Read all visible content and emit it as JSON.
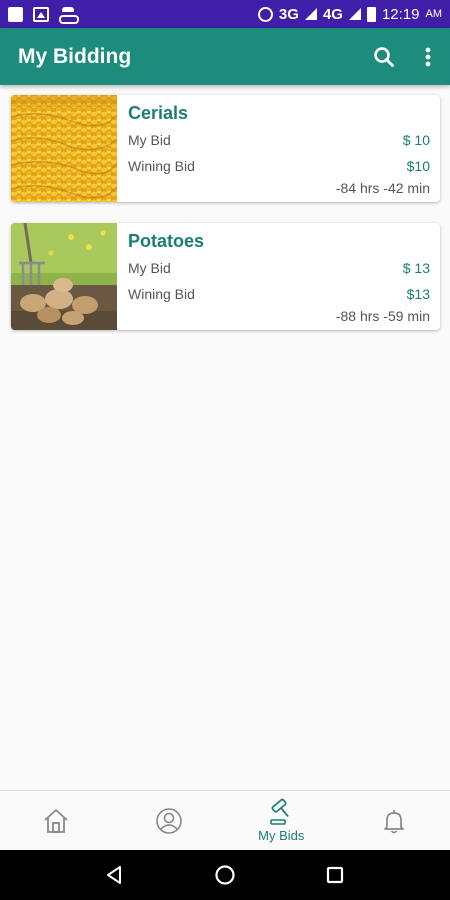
{
  "status_bar": {
    "network_3g": "3G",
    "network_4g": "4G",
    "time": "12:19",
    "ampm": "AM"
  },
  "app_bar": {
    "title": "My Bidding",
    "color": "#1e8c7d"
  },
  "items": [
    {
      "title": "Cerials",
      "my_bid_label": "My Bid",
      "my_bid_value": "$ 10",
      "winning_bid_label": "Wining Bid",
      "winning_bid_value": "$10",
      "time_left": "-84 hrs -42 min",
      "image": "corn-photo"
    },
    {
      "title": "Potatoes",
      "my_bid_label": "My Bid",
      "my_bid_value": "$ 13",
      "winning_bid_label": "Wining Bid",
      "winning_bid_value": "$13",
      "time_left": "-88 hrs -59 min",
      "image": "potatoes-photo"
    }
  ],
  "bottom_nav": {
    "items": [
      {
        "icon": "home-icon",
        "label": ""
      },
      {
        "icon": "profile-icon",
        "label": ""
      },
      {
        "icon": "gavel-icon",
        "label": "My Bids",
        "active": true
      },
      {
        "icon": "bell-icon",
        "label": ""
      }
    ]
  },
  "colors": {
    "status_bar": "#3f1ea8",
    "accent": "#1a7f72"
  }
}
